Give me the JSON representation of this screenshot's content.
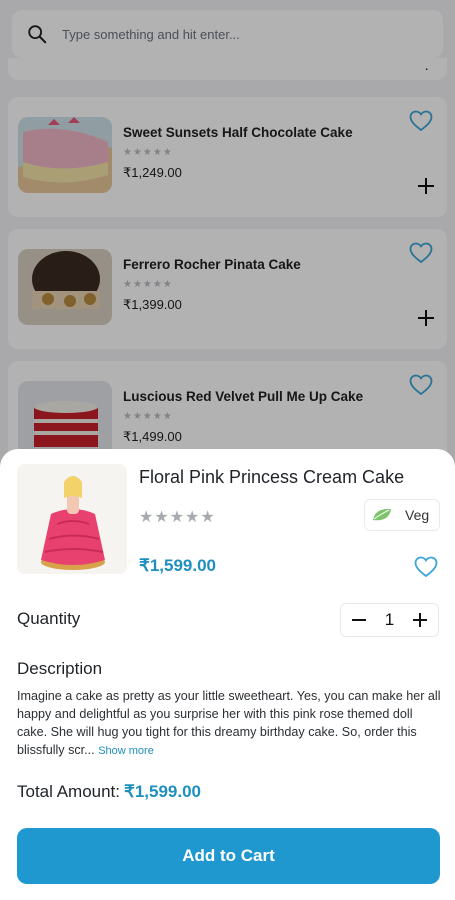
{
  "search": {
    "placeholder": "Type something and hit enter..."
  },
  "products": [
    {
      "name": "Sweet Sunsets Half Chocolate Cake",
      "stars": "★★★★★",
      "price": "₹1,249.00"
    },
    {
      "name": "Ferrero Rocher Pinata Cake",
      "stars": "★★★★★",
      "price": "₹1,399.00"
    },
    {
      "name": "Luscious Red Velvet Pull Me Up Cake",
      "stars": "★★★★★",
      "price": "₹1,499.00"
    }
  ],
  "detail": {
    "title": "Floral Pink Princess Cream Cake",
    "stars": "★★★★★",
    "veg_label": "Veg",
    "price": "₹1,599.00",
    "quantity_label": "Quantity",
    "quantity": "1",
    "description_heading": "Description",
    "description": "Imagine a cake as pretty as your little sweetheart. Yes, you can make her all happy and delightful as you surprise her with this pink rose themed doll cake. She will hug you tight for this dreamy birthday cake. So, order this blissfully scr...",
    "show_more": "Show more",
    "total_label": "Total Amount:",
    "total_amount": "₹1,599.00",
    "add_to_cart": "Add to Cart"
  },
  "colors": {
    "accent": "#1f98cf",
    "price": "#1f8fc0",
    "scrim": "rgba(0,0,0,0.30)"
  },
  "icons": [
    "search-icon",
    "heart-icon",
    "plus-icon",
    "minus-icon",
    "veg-leaf-icon"
  ]
}
